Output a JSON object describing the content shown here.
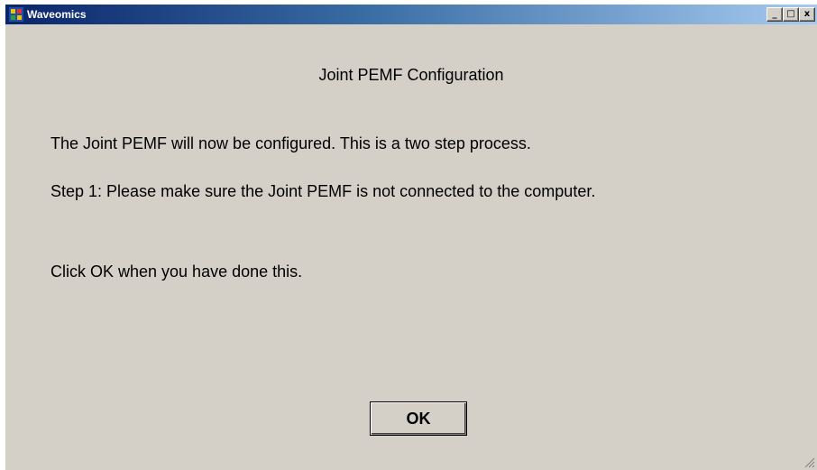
{
  "window": {
    "title": "Waveomics",
    "controls": {
      "minimize": "_",
      "maximize": "□",
      "close": "x"
    }
  },
  "dialog": {
    "heading": "Joint PEMF Configuration",
    "line1": "The Joint PEMF will now be configured.  This is a two step process.",
    "line2": "Step 1: Please make sure the Joint PEMF is not connected to the computer.",
    "line3": "Click OK when you have done this.",
    "ok_label": "OK"
  },
  "icons": {
    "app": "app-icon",
    "resize": "resize-grip-icon"
  }
}
